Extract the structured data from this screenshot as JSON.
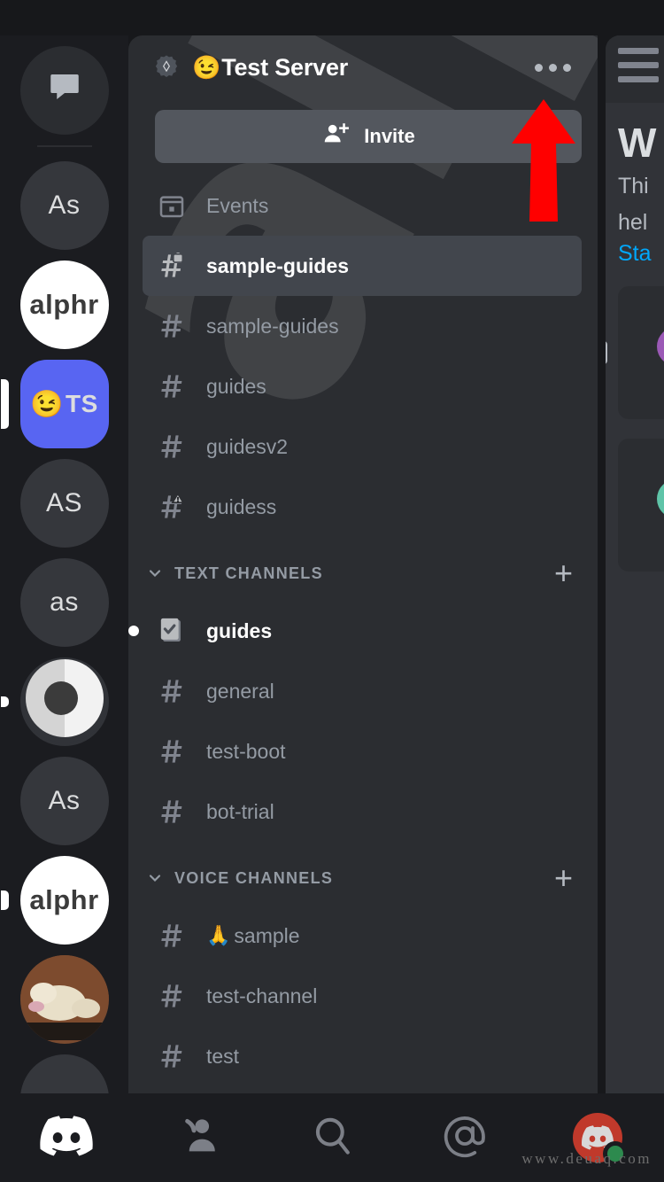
{
  "app": {
    "name": "Discord"
  },
  "server_rail": {
    "items": [
      {
        "name": "direct-messages",
        "label": "",
        "icon": "chat-bubble-icon",
        "bg": "#2b2d31",
        "shape": "circle",
        "pill": "none"
      },
      {
        "name": "server-as-1",
        "label": "As",
        "icon": "",
        "bg": "#35373c",
        "shape": "circle",
        "pill": "none"
      },
      {
        "name": "server-alphr-1",
        "label": "alphr",
        "icon": "",
        "bg": "#ffffff",
        "shape": "circle",
        "pill": "none"
      },
      {
        "name": "server-test-server",
        "label": "TS",
        "emoji": "😉",
        "bg": "#5865f2",
        "shape": "square",
        "pill": "full"
      },
      {
        "name": "server-as-2",
        "label": "AS",
        "icon": "",
        "bg": "#35373c",
        "shape": "circle",
        "pill": "none"
      },
      {
        "name": "server-as-3",
        "label": "as",
        "icon": "",
        "bg": "#35373c",
        "shape": "circle",
        "pill": "none"
      },
      {
        "name": "server-logo-ring",
        "label": "",
        "icon": "ring-logo-icon",
        "bg": "#313338",
        "shape": "circle",
        "pill": "dot"
      },
      {
        "name": "server-as-4",
        "label": "As",
        "icon": "",
        "bg": "#35373c",
        "shape": "circle",
        "pill": "none"
      },
      {
        "name": "server-alphr-2",
        "label": "alphr",
        "icon": "",
        "bg": "#ffffff",
        "shape": "circle",
        "pill": "small"
      },
      {
        "name": "server-dog-avatar",
        "label": "",
        "icon": "dog-photo-icon",
        "bg": "#7a4b30",
        "shape": "circle",
        "pill": "none"
      },
      {
        "name": "server-partial",
        "label": "",
        "icon": "",
        "bg": "#35373c",
        "shape": "circle",
        "pill": "none"
      }
    ]
  },
  "panel": {
    "header": {
      "badge_icon": "verified-server-badge-icon",
      "server_emoji": "😉",
      "server_name": "Test Server",
      "overflow_icon": "more-options-icon"
    },
    "invite": {
      "label": "Invite",
      "icon": "add-person-icon"
    },
    "top_channels": [
      {
        "name": "events",
        "label": "Events",
        "icon": "calendar-icon",
        "state": "normal"
      },
      {
        "name": "sample-guides-private",
        "label": "sample-guides",
        "icon": "hash-lock-icon",
        "state": "active"
      },
      {
        "name": "sample-guides",
        "label": "sample-guides",
        "icon": "hash-icon",
        "state": "normal"
      },
      {
        "name": "guides",
        "label": "guides",
        "icon": "hash-icon",
        "state": "normal"
      },
      {
        "name": "guidesv2",
        "label": "guidesv2",
        "icon": "hash-icon",
        "state": "normal"
      },
      {
        "name": "guidess",
        "label": "guidess",
        "icon": "hash-warning-icon",
        "state": "normal"
      }
    ],
    "categories": [
      {
        "name": "text-channels",
        "label": "TEXT CHANNELS",
        "chevron_icon": "chevron-down-icon",
        "add_icon": "plus-icon",
        "channels": [
          {
            "name": "guides",
            "label": "guides",
            "icon": "rules-channel-icon",
            "state": "unread"
          },
          {
            "name": "general",
            "label": "general",
            "icon": "hash-icon",
            "state": "normal"
          },
          {
            "name": "test-boot",
            "label": "test-boot",
            "icon": "hash-icon",
            "state": "normal"
          },
          {
            "name": "bot-trial",
            "label": "bot-trial",
            "icon": "hash-icon",
            "state": "normal"
          }
        ]
      },
      {
        "name": "voice-channels",
        "label": "VOICE CHANNELS",
        "chevron_icon": "chevron-down-icon",
        "add_icon": "plus-icon",
        "channels": [
          {
            "name": "sample",
            "label": "sample",
            "emoji": "🙏",
            "icon": "hash-icon",
            "state": "normal"
          },
          {
            "name": "test-channel",
            "label": "test-channel",
            "icon": "hash-icon",
            "state": "normal"
          },
          {
            "name": "test",
            "label": "test",
            "icon": "hash-icon",
            "state": "normal"
          }
        ]
      }
    ],
    "watermark_text": "alphr"
  },
  "chat_peek": {
    "menu_icon": "hamburger-menu-icon",
    "title": "W",
    "line1": "Thi",
    "line2": "hel",
    "link": "Sta"
  },
  "annotation": {
    "arrow_icon": "red-up-arrow-icon",
    "color": "#ff0000"
  },
  "bottom_nav": {
    "items": [
      {
        "name": "nav-home",
        "icon": "discord-logo-icon",
        "active": true
      },
      {
        "name": "nav-friends",
        "icon": "friends-icon",
        "active": false
      },
      {
        "name": "nav-search",
        "icon": "search-icon",
        "active": false
      },
      {
        "name": "nav-mentions",
        "icon": "mentions-at-icon",
        "active": false
      },
      {
        "name": "nav-profile",
        "icon": "user-avatar-icon",
        "active": false,
        "status": "online"
      }
    ]
  },
  "watermark_url": "www.deuaq.com",
  "colors": {
    "brand": "#5865f2",
    "panel_bg": "#2b2d31",
    "rail_bg": "#1b1c20",
    "active_row": "#42464d",
    "text_muted": "#949ba4",
    "text_bright": "#ffffff",
    "link": "#00a8fc",
    "online": "#3ba55d",
    "arrow": "#ff0000"
  }
}
